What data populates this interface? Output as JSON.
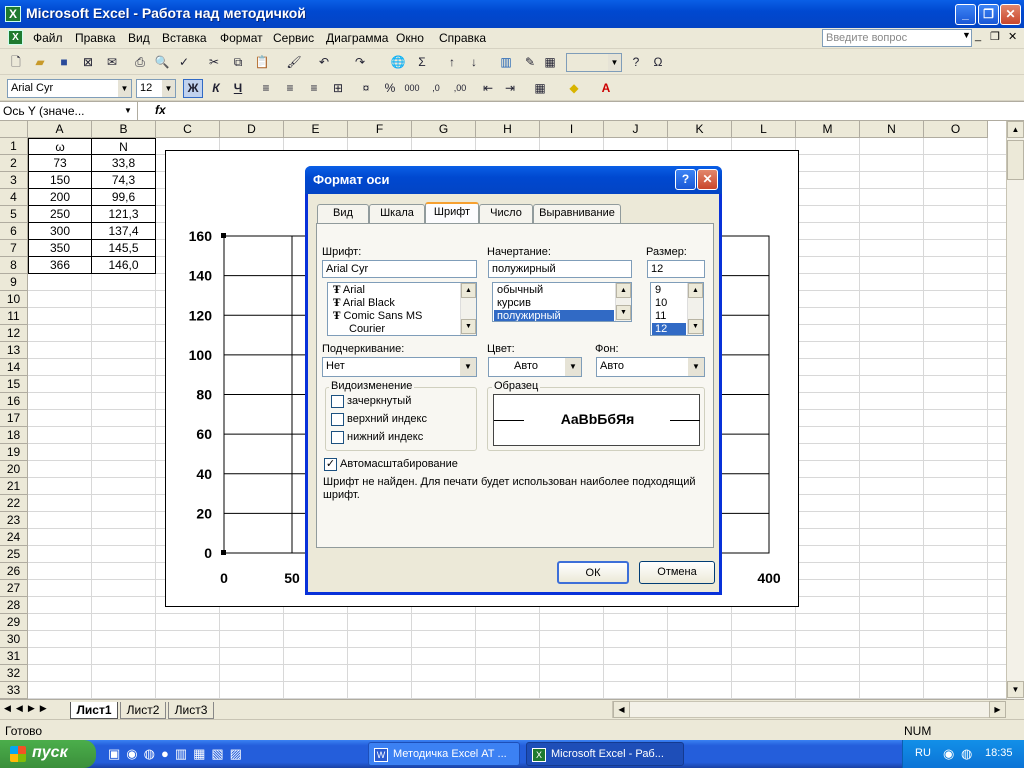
{
  "window": {
    "title": "Microsoft Excel - Работа над методичкой",
    "minimize": "_",
    "restore": "❐",
    "close": "✕"
  },
  "menu": [
    "Файл",
    "Правка",
    "Вид",
    "Вставка",
    "Формат",
    "Сервис",
    "Диаграмма",
    "Окно",
    "Справка"
  ],
  "ask_box": {
    "placeholder": "Введите вопрос"
  },
  "formatting": {
    "font": "Arial Cyr",
    "size": "12",
    "bold": "Ж",
    "italic": "К",
    "underline": "Ч"
  },
  "name_box": "Ось Y (значе...",
  "fx": "fx",
  "columns": [
    "A",
    "B",
    "C",
    "D",
    "E",
    "F",
    "G",
    "H",
    "I",
    "J",
    "K",
    "L",
    "M",
    "N",
    "O"
  ],
  "rows": [
    "1",
    "2",
    "3",
    "4",
    "5",
    "6",
    "7",
    "8",
    "9",
    "10",
    "11",
    "12",
    "13",
    "14",
    "15",
    "16",
    "17",
    "18",
    "19",
    "20",
    "21",
    "22",
    "23",
    "24",
    "25",
    "26",
    "27",
    "28",
    "29",
    "30",
    "31",
    "32",
    "33"
  ],
  "table": {
    "headers": [
      "ω",
      "N"
    ],
    "rows": [
      [
        "73",
        "33,8"
      ],
      [
        "150",
        "74,3"
      ],
      [
        "200",
        "99,6"
      ],
      [
        "250",
        "121,3"
      ],
      [
        "300",
        "137,4"
      ],
      [
        "350",
        "145,5"
      ],
      [
        "366",
        "146,0"
      ]
    ]
  },
  "chart_data": {
    "type": "line",
    "y_ticks": [
      "160",
      "140",
      "120",
      "100",
      "80",
      "60",
      "40",
      "20",
      "0"
    ],
    "x_ticks": [
      "0",
      "50",
      "400"
    ],
    "ylim": [
      0,
      160
    ],
    "grid": true
  },
  "sheets": [
    "Лист1",
    "Лист2",
    "Лист3"
  ],
  "status": {
    "ready": "Готово",
    "num": "NUM"
  },
  "taskbar": {
    "start": "пуск",
    "tasks": [
      "Методичка Excel АТ ...",
      "Microsoft Excel - Раб..."
    ],
    "lang": "RU",
    "time": "18:35"
  },
  "dialog": {
    "title": "Формат оси",
    "tabs": [
      "Вид",
      "Шкала",
      "Шрифт",
      "Число",
      "Выравнивание"
    ],
    "font_label": "Шрифт:",
    "font_value": "Arial Cyr",
    "font_list": [
      "Arial",
      "Arial Black",
      "Comic Sans MS",
      "Courier"
    ],
    "style_label": "Начертание:",
    "style_value": "полужирный",
    "style_list": [
      "обычный",
      "курсив",
      "полужирный"
    ],
    "size_label": "Размер:",
    "size_value": "12",
    "size_list": [
      "9",
      "10",
      "11",
      "12"
    ],
    "underline_label": "Подчеркивание:",
    "underline_value": "Нет",
    "color_label": "Цвет:",
    "color_value": "Авто",
    "bg_label": "Фон:",
    "bg_value": "Авто",
    "effects_label": "Видоизменение",
    "effects": [
      "зачеркнутый",
      "верхний индекс",
      "нижний индекс"
    ],
    "sample_label": "Образец",
    "sample_text": "AaBbБбЯя",
    "autoscale": "Автомасштабирование",
    "note": "Шрифт не найден. Для печати будет использован наиболее подходящий шрифт.",
    "ok": "ОК",
    "cancel": "Отмена",
    "help": "?",
    "close": "✕"
  }
}
